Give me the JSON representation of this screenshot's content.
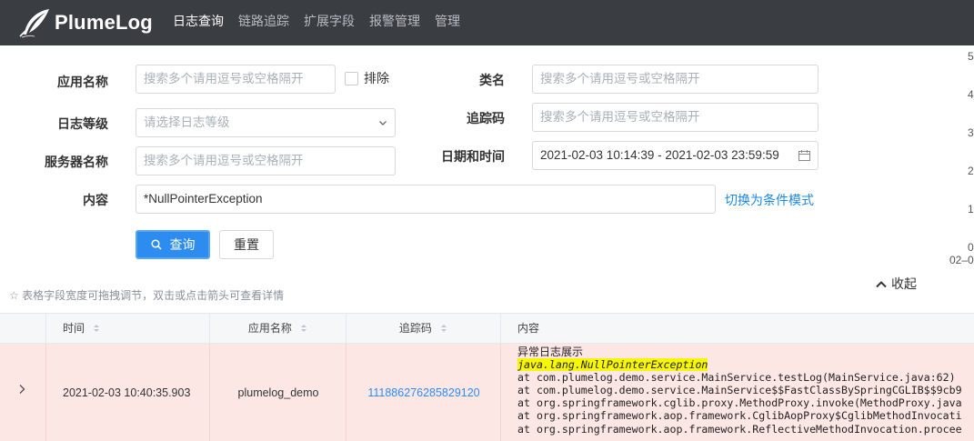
{
  "app": {
    "name": "PlumeLog"
  },
  "nav": [
    {
      "label": "日志查询",
      "active": true
    },
    {
      "label": "链路追踪",
      "active": false
    },
    {
      "label": "扩展字段",
      "active": false
    },
    {
      "label": "报警管理",
      "active": false
    },
    {
      "label": "管理",
      "active": false
    }
  ],
  "form": {
    "app_name": {
      "label": "应用名称",
      "placeholder": "搜索多个请用逗号或空格隔开",
      "value": ""
    },
    "exclude": {
      "label": "排除",
      "checked": false
    },
    "class_name": {
      "label": "类名",
      "placeholder": "搜索多个请用逗号或空格隔开",
      "value": ""
    },
    "log_level": {
      "label": "日志等级",
      "placeholder": "请选择日志等级",
      "value": ""
    },
    "trace_id": {
      "label": "追踪码",
      "placeholder": "搜索多个请用逗号或空格隔开",
      "value": ""
    },
    "server_name": {
      "label": "服务器名称",
      "placeholder": "搜索多个请用逗号或空格隔开",
      "value": ""
    },
    "datetime": {
      "label": "日期和时间",
      "value": "2021-02-03 10:14:39 - 2021-02-03 23:59:59"
    },
    "content": {
      "label": "内容",
      "value": "*NullPointerException"
    },
    "switch_mode": "切换为条件模式",
    "search_btn": "查询",
    "reset_btn": "重置"
  },
  "hint": "☆ 表格字段宽度可拖拽调节，双击或点击箭头可查看详情",
  "collapse": "收起",
  "chart_axis": {
    "y_ticks": [
      "5",
      "4",
      "3",
      "2",
      "1",
      "0"
    ],
    "x_tick": "02–0"
  },
  "table": {
    "columns": [
      "时间",
      "应用名称",
      "追踪码",
      "内容"
    ],
    "rows": [
      {
        "time": "2021-02-03 10:40:35.903",
        "app": "plumelog_demo",
        "trace": "111886276285829120",
        "content": {
          "title": "异常日志展示",
          "highlight": "java.lang.NullPointerException",
          "lines": [
            "at com.plumelog.demo.service.MainService.testLog(MainService.java:62)",
            "at com.plumelog.demo.service.MainService$$FastClassBySpringCGLIB$$9cb9",
            "at org.springframework.cglib.proxy.MethodProxy.invoke(MethodProxy.java",
            "at org.springframework.aop.framework.CglibAopProxy$CglibMethodInvocati",
            "at org.springframework.aop.framework.ReflectiveMethodInvocation.procee"
          ]
        }
      }
    ]
  },
  "colors": {
    "topbar": "#3a3d42",
    "primary": "#2d8cf0",
    "error_row": "#fde7e5",
    "highlight": "#f7f700"
  }
}
